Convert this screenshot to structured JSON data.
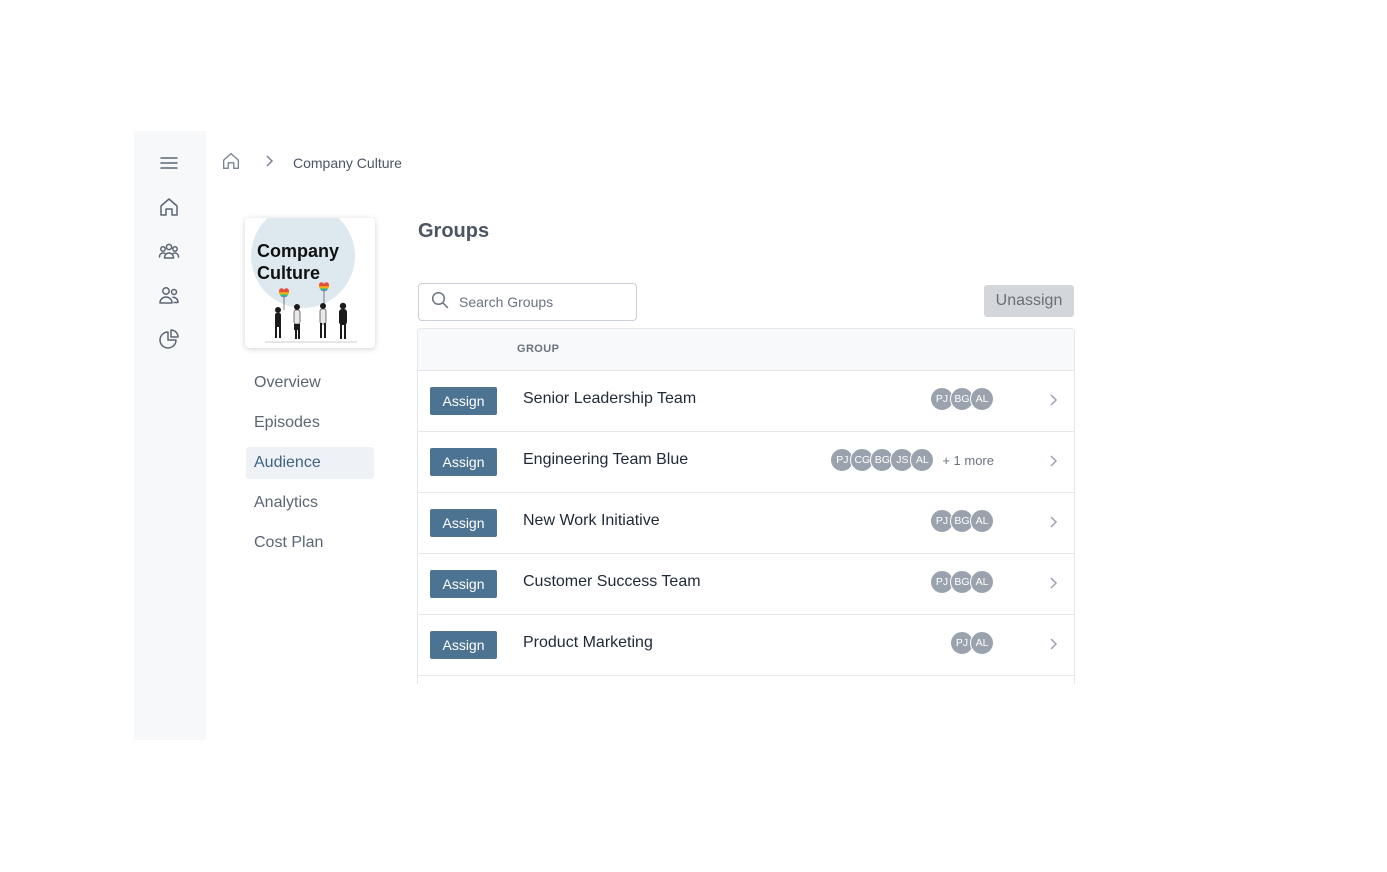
{
  "rail": {
    "items": [
      {
        "icon": "menu-icon"
      },
      {
        "icon": "home-icon"
      },
      {
        "icon": "groups-icon"
      },
      {
        "icon": "people-icon"
      },
      {
        "icon": "pie-chart-icon"
      }
    ]
  },
  "breadcrumb": {
    "home_icon": "home-icon",
    "separator_icon": "chevron-right-icon",
    "current": "Company Culture"
  },
  "cover": {
    "title_line1": "Company",
    "title_line2": "Culture"
  },
  "subnav": {
    "items": [
      {
        "label": "Overview"
      },
      {
        "label": "Episodes"
      },
      {
        "label": "Audience",
        "active": true
      },
      {
        "label": "Analytics"
      },
      {
        "label": "Cost Plan"
      }
    ]
  },
  "main": {
    "title": "Groups",
    "search": {
      "placeholder": "Search Groups",
      "value": ""
    },
    "unassign_label": "Unassign"
  },
  "table": {
    "header": "GROUP",
    "rows": [
      {
        "action": "Assign",
        "name": "Senior Leadership Team",
        "avatars": [
          "PJ",
          "BG",
          "AL"
        ],
        "more": ""
      },
      {
        "action": "Assign",
        "name": "Engineering Team Blue",
        "avatars": [
          "PJ",
          "CG",
          "BG",
          "JS",
          "AL"
        ],
        "more": "+ 1 more"
      },
      {
        "action": "Assign",
        "name": "New Work Initiative",
        "avatars": [
          "PJ",
          "BG",
          "AL"
        ],
        "more": ""
      },
      {
        "action": "Assign",
        "name": "Customer Success Team",
        "avatars": [
          "PJ",
          "BG",
          "AL"
        ],
        "more": ""
      },
      {
        "action": "Assign",
        "name": "Product Marketing",
        "avatars": [
          "PJ",
          "AL"
        ],
        "more": ""
      }
    ]
  },
  "colors": {
    "assign_button": "#4d7393",
    "active_nav_text": "#3f6384",
    "avatar": "#9aa3ad",
    "unassign_button": "#d3d6da"
  }
}
